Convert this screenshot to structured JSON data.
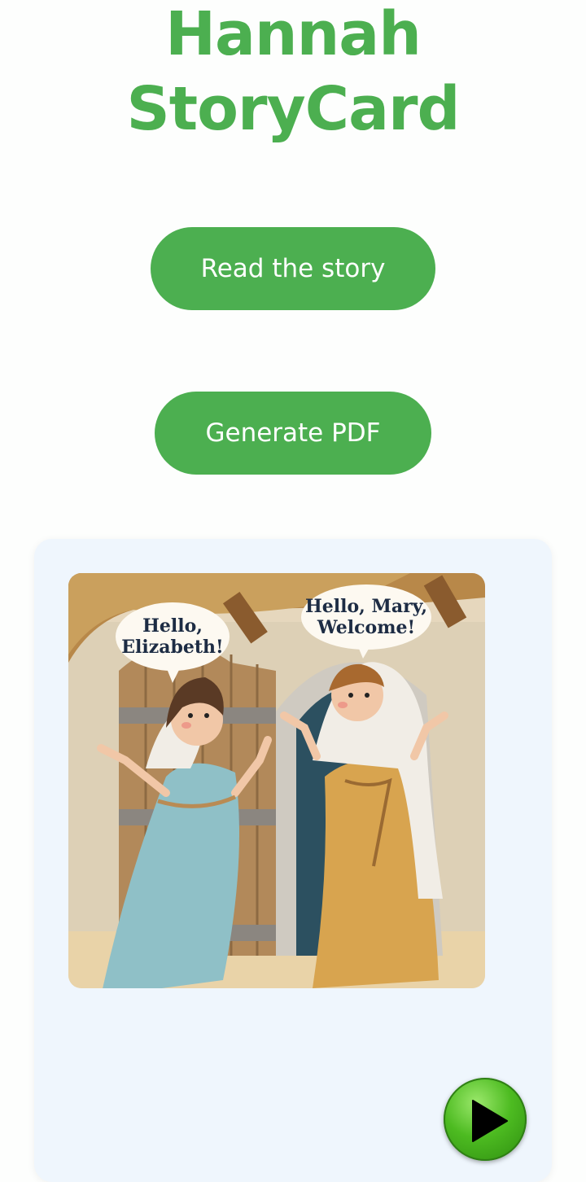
{
  "header": {
    "title_line1": "Hannah",
    "title_line2": "StoryCard"
  },
  "actions": {
    "read_label": "Read the story",
    "pdf_label": "Generate PDF"
  },
  "card": {
    "illustration": {
      "left_bubble_line1": "Hello,",
      "left_bubble_line2": "Elizabeth!",
      "right_bubble_line1": "Hello, Mary,",
      "right_bubble_line2": "Welcome!"
    },
    "play_icon": "play-icon"
  },
  "colors": {
    "accent": "#4caf50",
    "card_bg": "#eff6fd",
    "play_green": "#4dbb21"
  }
}
